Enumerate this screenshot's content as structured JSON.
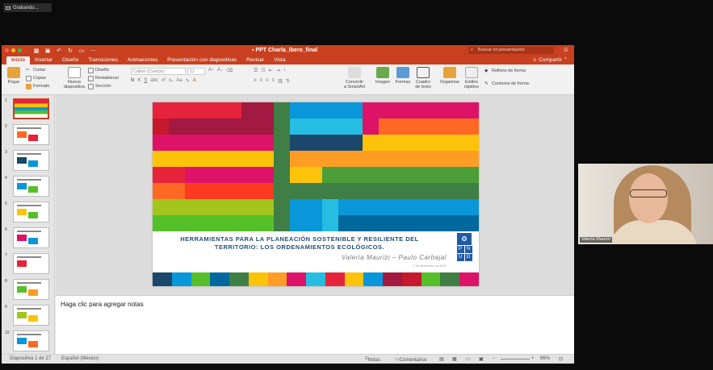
{
  "recording": {
    "label": "Grabando..."
  },
  "titlebar": {
    "document_title": "PPT Charla_Ibero_final",
    "search_placeholder": "Buscar en presentación"
  },
  "tabs": [
    "Inicio",
    "Insertar",
    "Diseño",
    "Transiciones",
    "Animaciones",
    "Presentación con diapositivas",
    "Revisar",
    "Vista"
  ],
  "share_label": "Compartir",
  "ribbon": {
    "paste": "Pegar",
    "cut": "Cortar",
    "copy": "Copiar",
    "format": "Formato",
    "new_slide_1": "Nueva",
    "new_slide_2": "diapositiva",
    "layout": "Diseño",
    "reset": "Restablecer",
    "section": "Sección",
    "font_name": "Calibri (Cuerpo)",
    "font_size": "12",
    "convert_1": "Convertir",
    "convert_2": "a SmartArt",
    "image": "Imagen",
    "shapes": "Formas",
    "textbox_1": "Cuadro",
    "textbox_2": "de texto",
    "arrange": "Organizar",
    "quick_styles_1": "Estilos",
    "quick_styles_2": "rápidos",
    "shape_fill": "Relleno de forma",
    "shape_outline": "Contorno de forma"
  },
  "thumbnails": [
    "1",
    "2",
    "3",
    "4",
    "5",
    "6",
    "7",
    "8",
    "9",
    "10"
  ],
  "slide": {
    "title_line1": "HERRAMIENTAS PARA LA PLANEACIÓN SOSTENIBLE Y RESILIENTE DEL",
    "title_line2": "TERRITORIO: LOS ORDENAMIENTOS ECOLÓGICOS.",
    "authors": "Valeria Maurizi – Paulo Carbajal",
    "date": "7 de diciembre de 2022",
    "logo_letters": [
      "P",
      "N",
      "U",
      "D"
    ]
  },
  "notes_placeholder": "Haga clic para agregar notas",
  "statusbar": {
    "slide_count": "Diapositiva 1 de 27",
    "language": "Español (México)",
    "notes": "Notas",
    "comments": "Comentarios",
    "zoom": "86%"
  },
  "webcam": {
    "name": "Valeria Maurizi"
  },
  "colors": {
    "accent": "#c8401f"
  }
}
